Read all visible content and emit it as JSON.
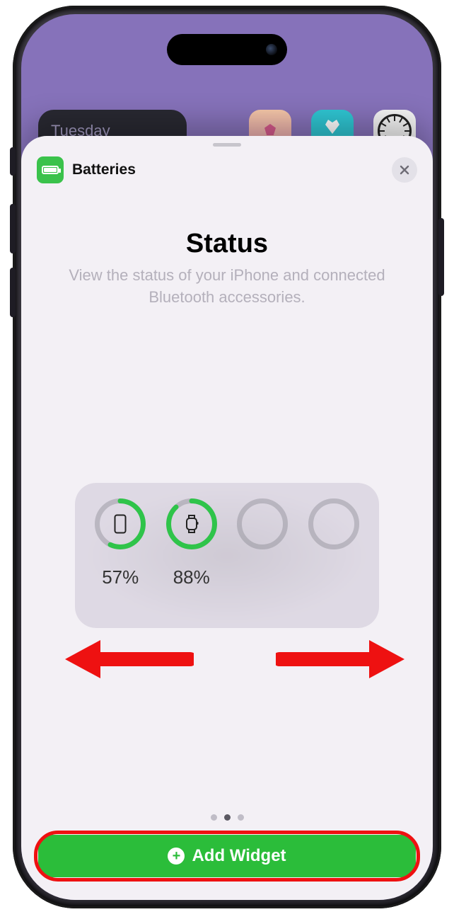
{
  "home": {
    "day_label": "Tuesday"
  },
  "sheet": {
    "app_name": "Batteries",
    "title": "Status",
    "subtitle": "View the status of your iPhone and connected Bluetooth accessories."
  },
  "widget_preview": {
    "devices": [
      {
        "name": "iPhone",
        "percent_label": "57%",
        "percent": 57,
        "icon": "iphone-icon"
      },
      {
        "name": "Apple Watch",
        "percent_label": "88%",
        "percent": 88,
        "icon": "watch-icon"
      },
      {
        "name": "empty",
        "percent_label": "",
        "percent": 0,
        "icon": ""
      },
      {
        "name": "empty",
        "percent_label": "",
        "percent": 0,
        "icon": ""
      }
    ]
  },
  "pager": {
    "count": 3,
    "active_index": 1
  },
  "cta": {
    "label": "Add Widget"
  },
  "colors": {
    "accent_green": "#2bbd3a",
    "ring_green": "#2fc44a",
    "annotation_red": "#e11"
  }
}
